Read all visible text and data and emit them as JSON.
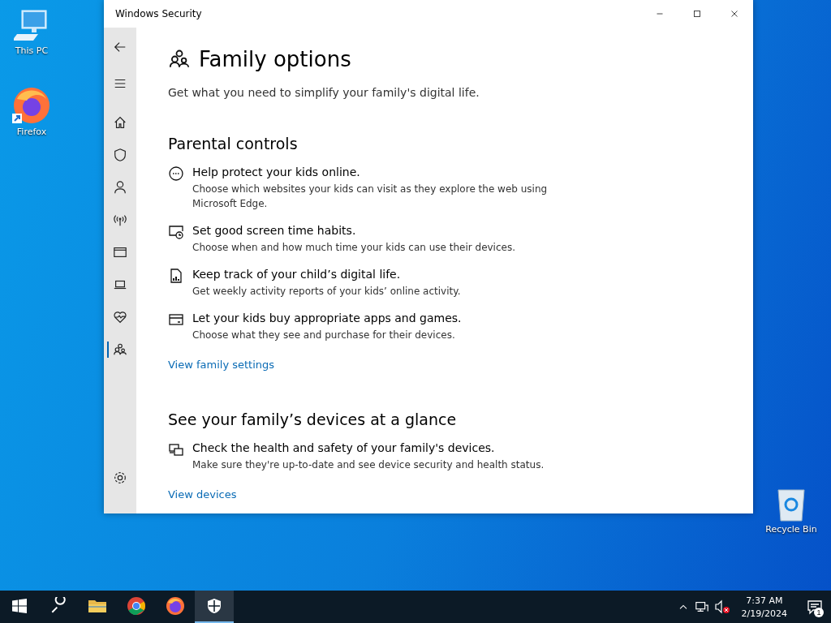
{
  "desktop_icons": [
    {
      "label": "This PC",
      "kind": "pc"
    },
    {
      "label": "Firefox",
      "kind": "firefox"
    },
    {
      "label": "Recycle Bin",
      "kind": "bin"
    }
  ],
  "window": {
    "title": "Windows Security"
  },
  "sidebar": {
    "items": [
      {
        "kind": "back",
        "selected": false
      },
      {
        "kind": "menu",
        "selected": false
      },
      {
        "kind": "home",
        "selected": false
      },
      {
        "kind": "shield",
        "selected": false
      },
      {
        "kind": "person",
        "selected": false
      },
      {
        "kind": "antenna",
        "selected": false
      },
      {
        "kind": "browser",
        "selected": false
      },
      {
        "kind": "laptop",
        "selected": false
      },
      {
        "kind": "heart",
        "selected": false
      },
      {
        "kind": "family",
        "selected": true
      },
      {
        "kind": "settings",
        "selected": false
      }
    ]
  },
  "page": {
    "title": "Family options",
    "subtitle": "Get what you need to simplify your family's digital life.",
    "sections": [
      {
        "heading": "Parental controls",
        "items": [
          {
            "kind": "web",
            "title": "Help protect your kids online.",
            "description": "Choose which websites your kids can visit as they explore the web using Microsoft Edge."
          },
          {
            "kind": "clock",
            "title": "Set good screen time habits.",
            "description": "Choose when and how much time your kids can use their devices."
          },
          {
            "kind": "report",
            "title": "Keep track of your child’s digital life.",
            "description": "Get weekly activity reports of your kids’ online activity."
          },
          {
            "kind": "card",
            "title": "Let your kids buy appropriate apps and games.",
            "description": "Choose what they see and purchase for their devices."
          }
        ],
        "link": "View family settings"
      },
      {
        "heading": "See your family’s devices at a glance",
        "items": [
          {
            "kind": "devices",
            "title": "Check the health and safety of your family's devices.",
            "description": "Make sure they're up-to-date and see device security and health status."
          }
        ],
        "link": "View devices"
      }
    ]
  },
  "taskbar": {
    "apps": [
      {
        "kind": "start",
        "selected": false
      },
      {
        "kind": "search",
        "selected": false
      },
      {
        "kind": "folder",
        "selected": false
      },
      {
        "kind": "chrome",
        "selected": false
      },
      {
        "kind": "firefox",
        "selected": false
      },
      {
        "kind": "security",
        "selected": true
      }
    ],
    "time": "7:37 AM",
    "date": "2/19/2024",
    "notification_count": "1"
  }
}
